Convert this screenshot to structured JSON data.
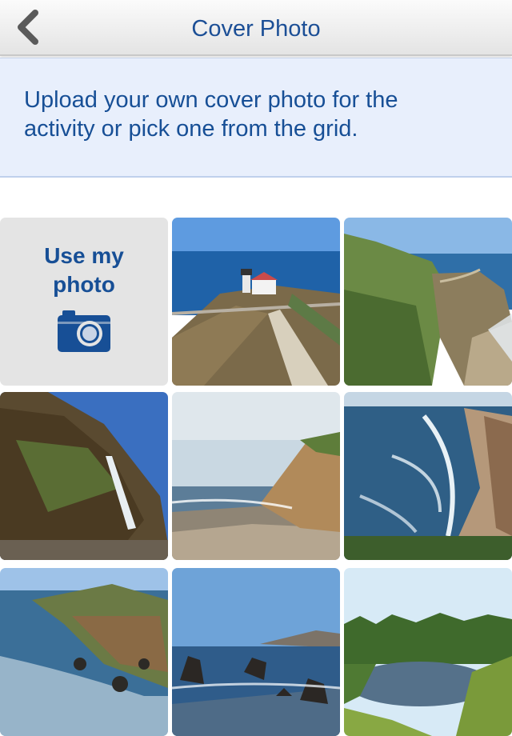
{
  "nav": {
    "title": "Cover Photo",
    "back_icon": "chevron-left-icon"
  },
  "info": {
    "text": "Upload your own cover photo for the activity or pick one from the grid."
  },
  "grid": {
    "upload_tile": {
      "label": "Use my photo",
      "icon": "camera-icon"
    },
    "photos": [
      {
        "scene": "lighthouse-stairs"
      },
      {
        "scene": "coastal-cliff-trail"
      },
      {
        "scene": "waterfall-cliff"
      },
      {
        "scene": "beach-bluff"
      },
      {
        "scene": "long-beach-waves"
      },
      {
        "scene": "rocky-headland"
      },
      {
        "scene": "sea-stacks"
      },
      {
        "scene": "forest-lake"
      }
    ]
  },
  "colors": {
    "accent": "#174f96",
    "info_bg": "#e8effc"
  }
}
